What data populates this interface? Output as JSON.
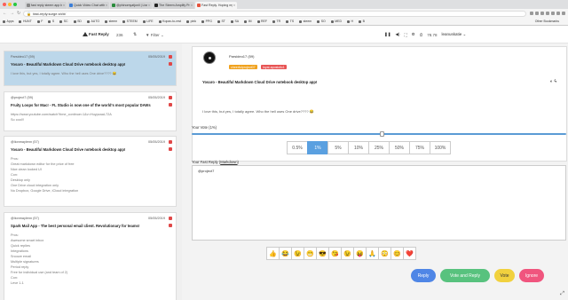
{
  "browser": {
    "tabs": [
      {
        "label": "fast reply steem app by @m",
        "active": false
      },
      {
        "label": "Quick Video Chat with @maso",
        "active": false
      },
      {
        "label": "@phinomyatjonli | Lissinwa",
        "active": false
      },
      {
        "label": "The Steem Amplify Project ft",
        "active": false
      },
      {
        "label": "Fast Reply. Hoping my mars",
        "active": true
      }
    ],
    "url": "fast-reply.surge.sh/#/",
    "bookmarks": [
      "Apps",
      "HUNT",
      "F",
      "S",
      "SC",
      "SD",
      "AUTO",
      "steem",
      "STEEM",
      "LIFE",
      "Kopax-to-rest",
      "pink",
      "PPG",
      "ST",
      "SA",
      "IM",
      "REF",
      "TR",
      "TS",
      "steem",
      "SO",
      "MED",
      "H",
      "B"
    ],
    "other_bookmarks": "Other Bookmarks"
  },
  "toolbar": {
    "logo": "Fast Reply",
    "count": "236",
    "sort_icon": "sort-icon",
    "filter_label": "Filter",
    "right": {
      "vote_power": "78.78",
      "user": "leanuskatie"
    }
  },
  "list": [
    {
      "author": "Parsideo17 (59)",
      "date": "05/05/2019",
      "title": "Yosaro - Beautiful Markdown Cloud Drive notebook desktop app!",
      "body": "I love this, but yes, I totally agree. Who the hell uses One drive???? 😂",
      "selected": true
    },
    {
      "author": "@project7 (59)",
      "date": "05/05/2019",
      "title": "Fruity Loops for Mac! - FL Studio is now one of the world's most popular DAWs",
      "body": "https://www.youtube.com/watch?time_continue=1&v=HuypzaaL72A\nSo cool!!",
      "selected": false
    },
    {
      "author": "@lionmaylenn (57)",
      "date": "05/05/2019",
      "title": "Yosaro - Beautiful Markdown Cloud Drive notebook desktop app!",
      "body": "Pros:\nGreat markdown editor for the price of free\nNice clean looked UI\nCon:\nDesktop only\nOne Drive cloud integration only\nNo Dropbox, Google Drive, iCloud integration",
      "selected": false
    },
    {
      "author": "@lionmaylenn (57)",
      "date": "05/05/2019",
      "title": "Spark Mail App - The best personal email client. Revolutionary for teams!",
      "body": "Pros:\nAwesome smart inbox\nQuick replies\nIntegrations\nSnooze email\nMultiple signatures\nPeriod reply\nFree for individual use (and team of 2)\nCon:\nLeve 1-1",
      "selected": false
    }
  ],
  "post": {
    "author": "Parsideo17 (59)",
    "badges": [
      "cheerfulproject07",
      "loyal-apostolic1"
    ],
    "title": "Yosaro - Beautiful Markdown Cloud Drive notebook desktop app!",
    "body": "I love this, but yes, I totally agree. Who the hell uses One drive???? 😂"
  },
  "vote": {
    "label": "Your Vote (1%)",
    "level_percent": 51,
    "options": [
      "0.5%",
      "1%",
      "5%",
      "10%",
      "25%",
      "50%",
      "75%",
      "100%"
    ],
    "selected": "1%"
  },
  "reply": {
    "label_prefix": "Your Fast Reply (",
    "label_link": "Markdown",
    "label_suffix": ")",
    "value": "@project7"
  },
  "emojis": [
    "👍",
    "😂",
    "😉",
    "😁",
    "😎",
    "😘",
    "😉",
    "😝",
    "🙏",
    "😳",
    "😊",
    "❤️"
  ],
  "actions": {
    "reply": "Reply",
    "vote_reply": "Vote and Reply",
    "vote": "Vote",
    "ignore": "Ignore"
  }
}
